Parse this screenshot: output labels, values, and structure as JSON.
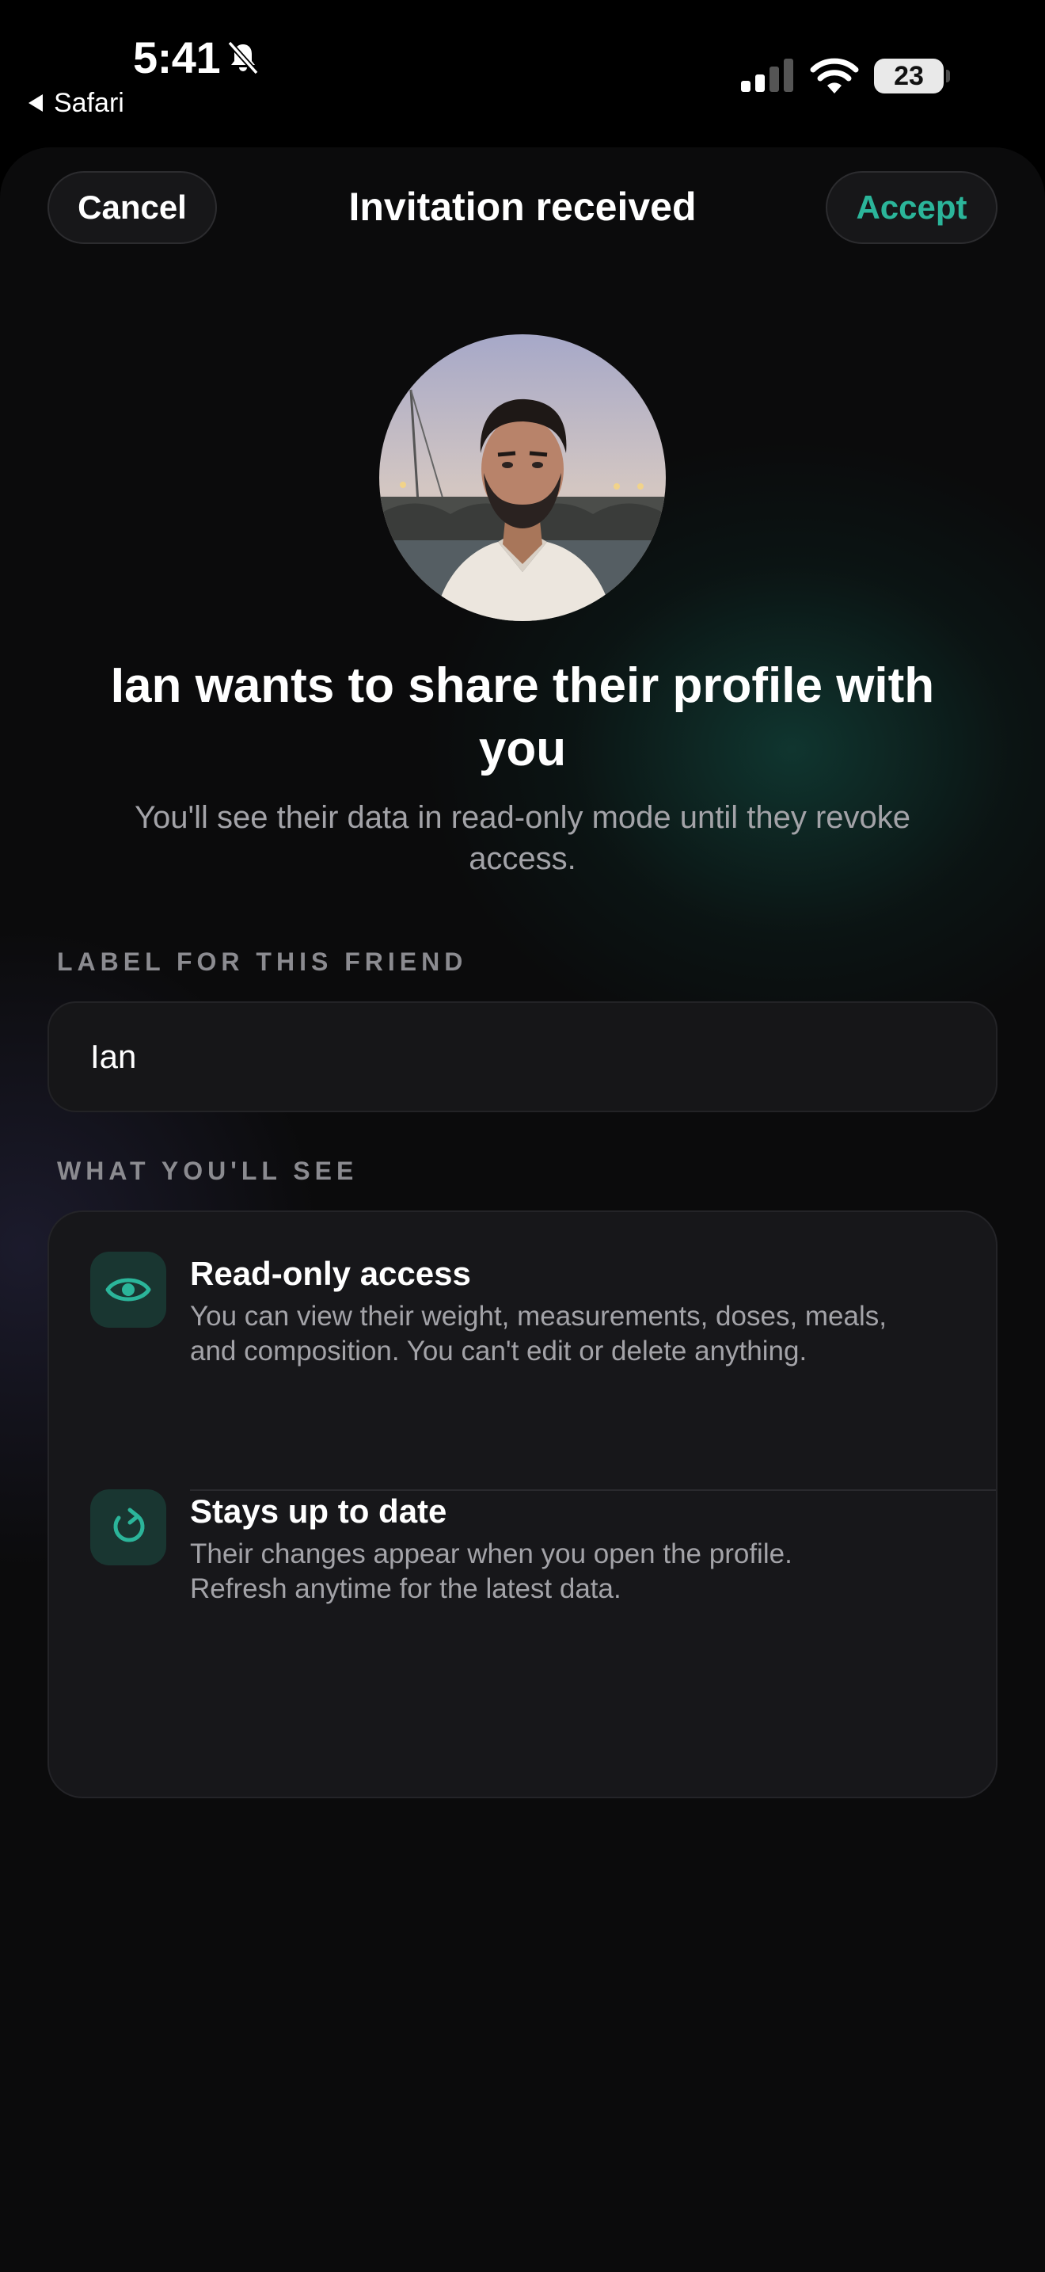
{
  "status_bar": {
    "time": "5:41",
    "back_label": "Safari",
    "battery": "23",
    "icons": [
      "bell-slash-icon",
      "cellular-signal-icon",
      "wifi-icon",
      "battery-icon"
    ]
  },
  "nav": {
    "cancel_label": "Cancel",
    "title": "Invitation received",
    "accept_label": "Accept"
  },
  "invite": {
    "headline": "Ian wants to share their profile with you",
    "subtitle": "You'll see their data in read-only mode until they revoke access."
  },
  "friend_label": {
    "section_title": "LABEL FOR THIS FRIEND",
    "value": "Ian"
  },
  "what_you_see": {
    "section_title": "WHAT YOU'LL SEE",
    "items": [
      {
        "icon": "eye-icon",
        "title": "Read-only access",
        "description": "You can view their weight, measurements, doses, meals, and composition. You can't edit or delete anything."
      },
      {
        "icon": "refresh-icon",
        "title": "Stays up to date",
        "description": "Their changes appear when you open the profile. Refresh anytime for the latest data."
      }
    ]
  },
  "colors": {
    "accent": "#2bb59a",
    "background": "#0b0b0c",
    "card": "#17171a",
    "secondary_text": "#a3a3a8"
  }
}
